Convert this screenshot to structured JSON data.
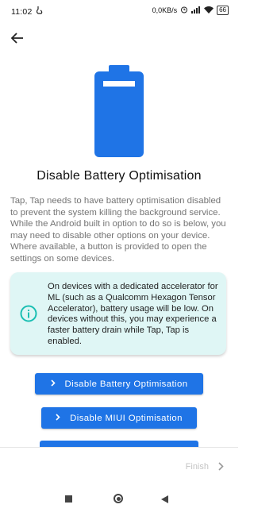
{
  "status_bar": {
    "time": "11:02",
    "net_speed": "0,0KB/s",
    "battery": "66"
  },
  "page": {
    "title": "Disable Battery Optimisation",
    "description": "Tap, Tap needs to have battery optimisation disabled to prevent the system killing the background service. While the Android built in option to do so is below, you may need to disable other options on your device. Where available, a button is provided to open the settings on some devices.",
    "info_text": "On devices with a dedicated accelerator for ML (such as a Qualcomm Hexagon Tensor Accelerator), battery usage will be low. On devices without this, you may experience a faster battery drain while Tap, Tap is enabled.",
    "buttons": [
      {
        "label": "Disable Battery Optimisation"
      },
      {
        "label": "Disable MIUI Optimisation"
      }
    ]
  },
  "footer": {
    "finish_label": "Finish"
  },
  "colors": {
    "accent": "#1f74e6",
    "info_bg": "#dff6f5",
    "info_icon": "#1bbfb3"
  },
  "icons": [
    "back-arrow-icon",
    "battery-icon",
    "info-icon",
    "chevron-right-icon"
  ]
}
